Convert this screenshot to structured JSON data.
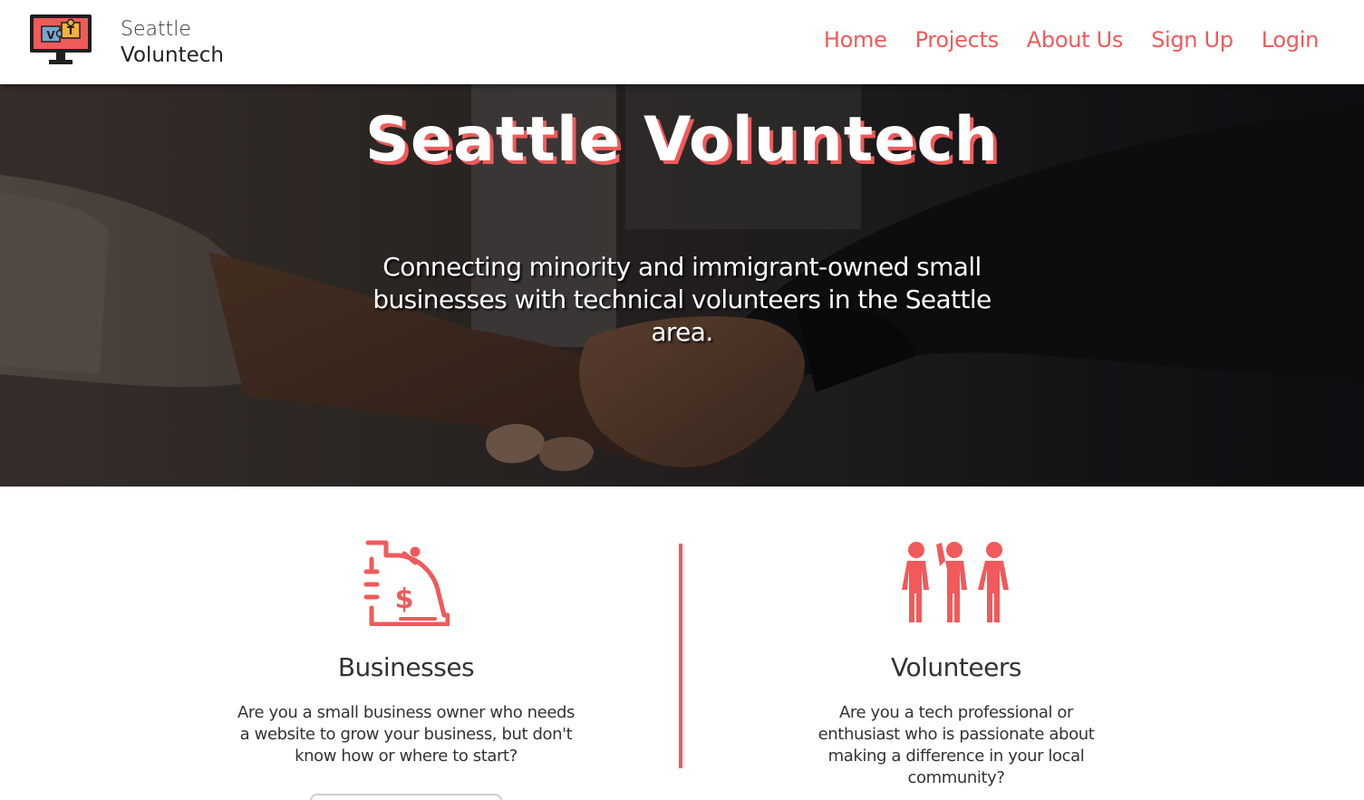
{
  "header": {
    "logo_letters": [
      "V",
      "T"
    ],
    "brand_line1": "Seattle",
    "brand_line2": "Voluntech",
    "nav": [
      {
        "label": "Home"
      },
      {
        "label": "Projects"
      },
      {
        "label": "About Us"
      },
      {
        "label": "Sign Up"
      },
      {
        "label": "Login"
      }
    ]
  },
  "hero": {
    "title": "Seattle Voluntech",
    "subtitle": "Connecting minority and immigrant-owned small businesses with technical volunteers in the Seattle area."
  },
  "sections": [
    {
      "icon": "cash-register-icon",
      "heading": "Businesses",
      "text": "Are you a small business owner who needs a website to grow your business, but don't know how or where to start?"
    },
    {
      "icon": "people-icon",
      "heading": "Volunteers",
      "text": "Are you a tech professional or enthusiast who is passionate about making a difference in your local community?"
    }
  ],
  "colors": {
    "accent": "#f05a5a",
    "text": "#333333",
    "header_bg": "#ffffff"
  }
}
